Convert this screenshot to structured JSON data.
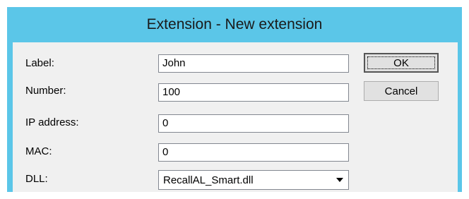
{
  "window": {
    "title": "Extension - New extension"
  },
  "form": {
    "label": {
      "caption": "Label:",
      "value": "John"
    },
    "number": {
      "caption": "Number:",
      "value": "100"
    },
    "ip": {
      "caption": "IP address:",
      "value": "0"
    },
    "mac": {
      "caption": "MAC:",
      "value": "0"
    },
    "dll": {
      "caption": "DLL:",
      "value": "RecallAL_Smart.dll"
    }
  },
  "buttons": {
    "ok": "OK",
    "cancel": "Cancel"
  },
  "icons": {
    "dropdown": "chevron-down-icon"
  },
  "colors": {
    "titlebar": "#5bc6e8",
    "client": "#f0f0f0"
  }
}
